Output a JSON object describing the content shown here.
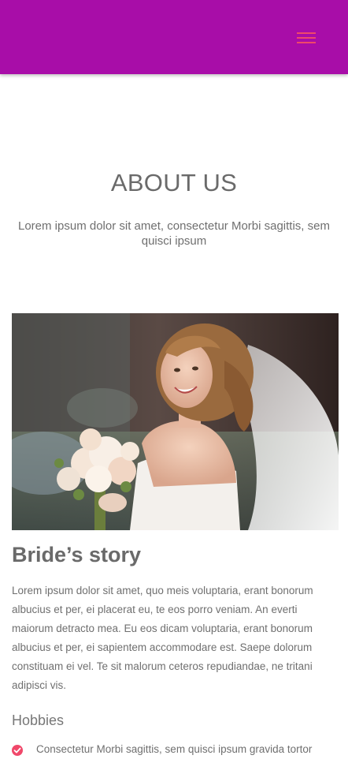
{
  "header": {
    "background_color": "#a80da8",
    "menu_icon": "hamburger-menu-icon",
    "menu_icon_color": "#f0486a"
  },
  "about": {
    "title": "ABOUT US",
    "subtitle": "Lorem ipsum dolor sit amet, consectetur Morbi sagittis, sem quisci ipsum"
  },
  "story": {
    "image_alt": "bride-photo",
    "title": "Bride’s story",
    "text": "Lorem ipsum dolor sit amet, quo meis voluptaria, erant bonorum albucius et per, ei placerat eu, te eos porro veniam. An everti maiorum detracto mea. Eu eos dicam voluptaria, erant bonorum albucius et per, ei sapientem accommodare est. Saepe dolorum constituam ei vel. Te sit malorum ceteros repudiandae, ne tritani adipisci vis.",
    "hobbies_title": "Hobbies",
    "hobbies": [
      {
        "icon": "check-circle-icon",
        "label": "Consectetur Morbi sagittis, sem quisci ipsum gravida tortor"
      }
    ]
  }
}
